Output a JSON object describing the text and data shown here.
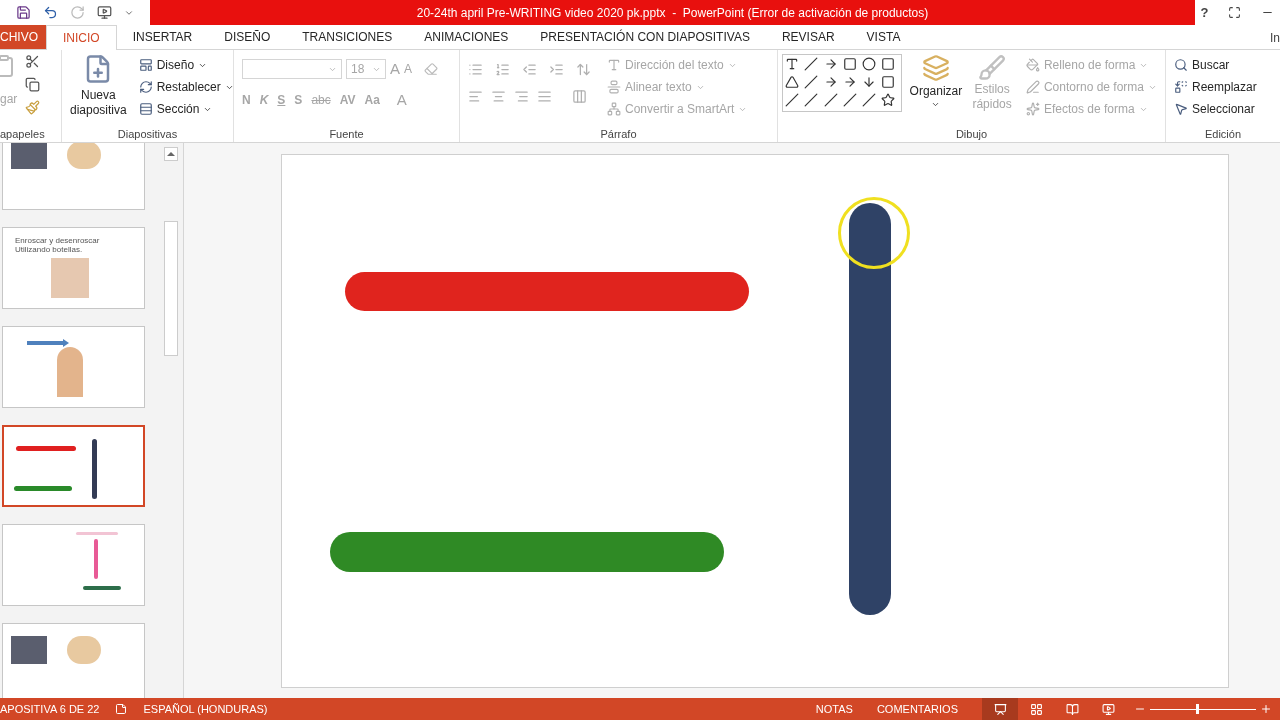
{
  "title_bar": {
    "title": "20-24th april Pre-WRITING video 2020 pk.pptx  -  PowerPoint (Error de activación de productos)",
    "help": "?"
  },
  "tabs": [
    {
      "label": "CHIVO",
      "kind": "file",
      "selected": false
    },
    {
      "label": "INICIO",
      "kind": "tab",
      "selected": true
    },
    {
      "label": "INSERTAR",
      "kind": "tab",
      "selected": false
    },
    {
      "label": "DISEÑO",
      "kind": "tab",
      "selected": false
    },
    {
      "label": "TRANSICIONES",
      "kind": "tab",
      "selected": false
    },
    {
      "label": "ANIMACIONES",
      "kind": "tab",
      "selected": false
    },
    {
      "label": "PRESENTACIÓN CON DIAPOSITIVAS",
      "kind": "tab",
      "selected": false
    },
    {
      "label": "REVISAR",
      "kind": "tab",
      "selected": false
    },
    {
      "label": "VISTA",
      "kind": "tab",
      "selected": false
    }
  ],
  "account": "In",
  "ribbon": {
    "clipboard": {
      "label": "apapeles",
      "paste": {
        "label": "gar",
        "disabled": true
      }
    },
    "slides": {
      "label": "Diapositivas",
      "new_slide": "Nueva diapositiva",
      "items": [
        {
          "label": "Diseño",
          "disabled": false
        },
        {
          "label": "Restablecer",
          "disabled": false
        },
        {
          "label": "Sección",
          "disabled": false
        }
      ]
    },
    "font": {
      "label": "Fuente",
      "font_size": "18",
      "disabled": true,
      "size_buttons": [
        "A",
        "A"
      ],
      "format_buttons": [
        "N",
        "K",
        "S",
        "S",
        "abc",
        "AV",
        "Aa"
      ],
      "color_button": "A"
    },
    "paragraph": {
      "label": "Párrafo",
      "disabled": true,
      "items": [
        {
          "label": "Dirección del texto"
        },
        {
          "label": "Alinear texto"
        },
        {
          "label": "Convertir a SmartArt"
        }
      ]
    },
    "drawing": {
      "label": "Dibujo",
      "arrange": "Organizar",
      "quick_styles": {
        "label": "Estilos rápidos",
        "disabled": true
      },
      "items": [
        {
          "label": "Relleno de forma",
          "disabled": true
        },
        {
          "label": "Contorno de forma",
          "disabled": true
        },
        {
          "label": "Efectos de forma",
          "disabled": true
        }
      ]
    },
    "editing": {
      "label": "Edición",
      "items": [
        {
          "label": "Buscar"
        },
        {
          "label": "Reemplazar"
        },
        {
          "label": "Seleccionar"
        }
      ]
    }
  },
  "thumbnails": [
    {
      "kind": "photos",
      "selected": false
    },
    {
      "kind": "bottle",
      "caption": "Enroscar y desenroscar Utilizando botellas.",
      "selected": false
    },
    {
      "kind": "arrow",
      "selected": false
    },
    {
      "kind": "sticks",
      "selected": true
    },
    {
      "kind": "forks",
      "selected": false
    },
    {
      "kind": "photos",
      "selected": false
    }
  ],
  "status_bar": {
    "slide": "APOSITIVA 6 DE 22",
    "language": "ESPAÑOL (HONDURAS)",
    "notes": "NOTAS",
    "comments": "COMENTARIOS",
    "views": [
      {
        "kind": "normal",
        "selected": true
      },
      {
        "kind": "sorter",
        "selected": false
      },
      {
        "kind": "reading",
        "selected": false
      },
      {
        "kind": "show",
        "selected": false
      }
    ],
    "zoom": {
      "level": 0.43
    }
  }
}
